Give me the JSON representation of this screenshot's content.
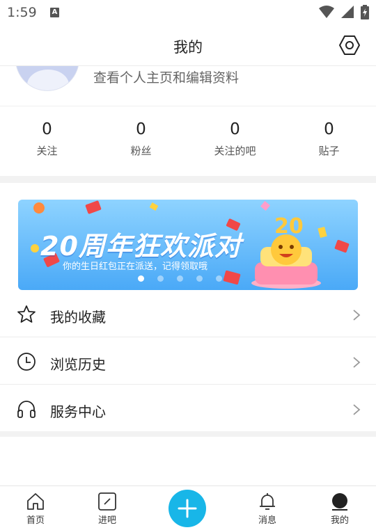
{
  "status_bar": {
    "time": "1:59",
    "notification_icon": "A"
  },
  "header": {
    "title": "我的",
    "settings_icon": "gear-hexagon-icon"
  },
  "profile": {
    "edit_link": "查看个人主页和编辑资料"
  },
  "stats": [
    {
      "value": "0",
      "label": "关注"
    },
    {
      "value": "0",
      "label": "粉丝"
    },
    {
      "value": "0",
      "label": "关注的吧"
    },
    {
      "value": "0",
      "label": "贴子"
    }
  ],
  "banner": {
    "title": "20周年狂欢派对",
    "subtitle": "你的生日红包正在派送，记得领取哦",
    "page_count": 5,
    "active_page": 1
  },
  "menu": [
    {
      "label": "我的收藏",
      "icon": "star-icon"
    },
    {
      "label": "浏览历史",
      "icon": "clock-icon"
    },
    {
      "label": "服务中心",
      "icon": "headphones-icon"
    }
  ],
  "bottom_nav": [
    {
      "label": "首页",
      "icon": "home-icon"
    },
    {
      "label": "进吧",
      "icon": "enter-bar-icon"
    },
    {
      "label": "",
      "icon": "plus-icon"
    },
    {
      "label": "消息",
      "icon": "bell-icon"
    },
    {
      "label": "我的",
      "icon": "profile-icon"
    }
  ],
  "colors": {
    "accent": "#18b6e8",
    "divider": "#f2f2f2",
    "banner_top": "#8ed3ff",
    "banner_bottom": "#4aa9f7"
  }
}
